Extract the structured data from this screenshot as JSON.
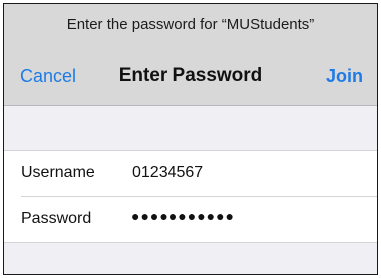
{
  "header": {
    "prompt": "Enter the password for “MUStudents”",
    "cancel_label": "Cancel",
    "title": "Enter Password",
    "join_label": "Join"
  },
  "colors": {
    "accent": "#1e7be6",
    "header_bg": "#d8d8d8",
    "page_bg": "#efeff4"
  },
  "form": {
    "username": {
      "label": "Username",
      "value": "01234567"
    },
    "password": {
      "label": "Password",
      "masked_value": "●●●●●●●●●●●"
    }
  }
}
